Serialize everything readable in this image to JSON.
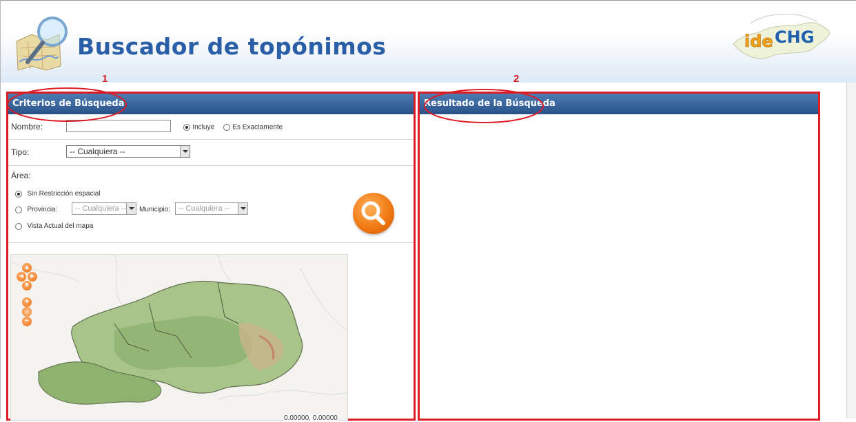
{
  "header": {
    "title": "Buscador de topónimos",
    "brand_prefix": "ide",
    "brand_suffix": "CHG"
  },
  "annotations": {
    "one": "1",
    "two": "2"
  },
  "left_panel": {
    "title": "Criterios de Búsqueda",
    "nombre_label": "Nombre:",
    "nombre_value": "",
    "match_options": [
      {
        "label": "Incluye",
        "selected": true
      },
      {
        "label": "Es Exactamente",
        "selected": false
      }
    ],
    "tipo_label": "Tipo:",
    "tipo_value": "-- Cualquiera --",
    "area_label": "Área:",
    "area_options": [
      {
        "label": "Sin Restricción espacial",
        "selected": true
      },
      {
        "label": "Provincia:",
        "selected": false
      },
      {
        "label": "Vista Actual del mapa",
        "selected": false
      }
    ],
    "provincia_value": "-- Cualquiera --",
    "municipio_label": "Municipio:",
    "municipio_value": "-- Cualquiera --",
    "coords": "0.00000, 0.00000"
  },
  "right_panel": {
    "title": "Resultado de la Búsqueda"
  },
  "colors": {
    "title_blue": "#2a5fa7",
    "panel_header": "#2a5289",
    "annotation_red": "#dd1c24",
    "search_orange": "#f07a14"
  },
  "icons": [
    "map-magnifier-logo-icon",
    "search-icon",
    "pan-up-icon",
    "pan-left-icon",
    "pan-right-icon",
    "pan-down-icon",
    "zoom-in-icon",
    "zoom-world-icon",
    "zoom-out-icon"
  ]
}
